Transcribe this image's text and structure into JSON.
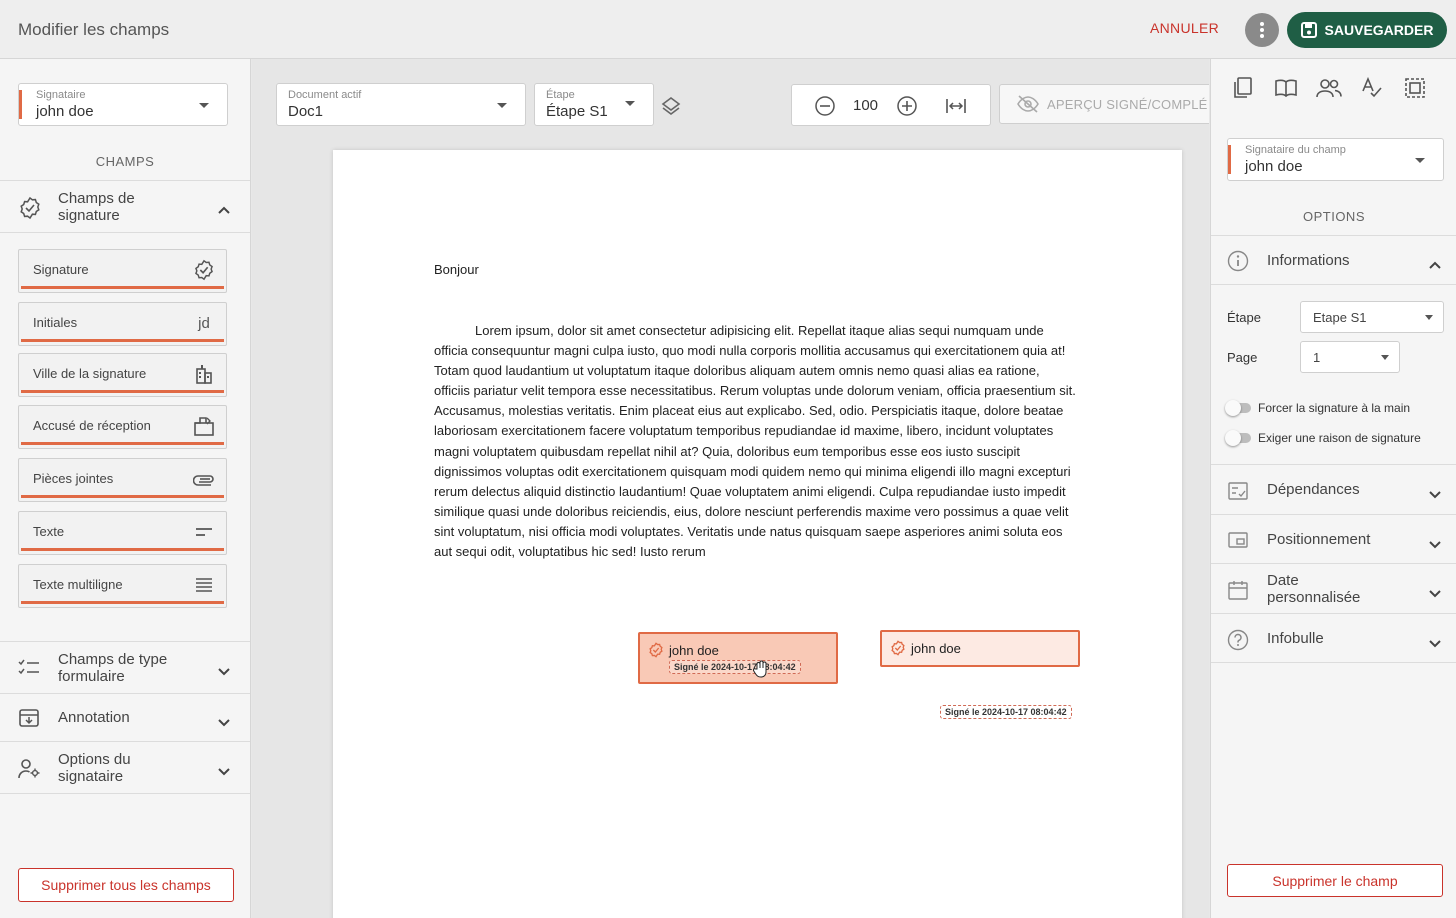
{
  "header": {
    "title": "Modifier les champs",
    "cancel_label": "ANNULER",
    "save_label": "SAUVEGARDER"
  },
  "left_panel": {
    "signer_select": {
      "label": "Signataire",
      "value": "john doe"
    },
    "section_title": "CHAMPS",
    "signature_group": {
      "label": "Champs de signature",
      "items": [
        {
          "label": "Signature",
          "icon": "verified-badge-icon"
        },
        {
          "label": "Initiales",
          "icon_text": "jd"
        },
        {
          "label": "Ville de la signature",
          "icon": "city-icon"
        },
        {
          "label": "Accusé de réception",
          "icon": "inbox-upload-icon"
        },
        {
          "label": "Pièces jointes",
          "icon": "paperclip-icon"
        },
        {
          "label": "Texte",
          "icon": "short-text-icon"
        },
        {
          "label": "Texte multiligne",
          "icon": "multiline-text-icon"
        }
      ]
    },
    "groups": [
      {
        "label": "Champs de type formulaire",
        "icon": "checklist-icon"
      },
      {
        "label": "Annotation",
        "icon": "annotation-icon"
      },
      {
        "label": "Options du signataire",
        "icon": "user-settings-icon"
      }
    ],
    "delete_all_label": "Supprimer tous les champs"
  },
  "toolbar": {
    "document_select": {
      "label": "Document actif",
      "value": "Doc1"
    },
    "step_select": {
      "label": "Étape",
      "value": "Étape S1"
    },
    "zoom_value": "100",
    "preview_label": "APERÇU SIGNÉ/COMPLÉ"
  },
  "document": {
    "greeting": "Bonjour",
    "paragraph": "Lorem ipsum, dolor sit amet consectetur adipisicing elit. Repellat itaque alias sequi numquam unde officia consequuntur magni culpa iusto, quo modi nulla corporis mollitia accusamus qui exercitationem quia at! Totam quod laudantium ut voluptatum itaque doloribus aliquam autem omnis nemo quasi alias ea ratione, officiis pariatur velit tempora esse necessitatibus. Rerum voluptas unde dolorum veniam, officia praesentium sit. Accusamus, molestias veritatis. Enim placeat eius aut explicabo. Sed, odio. Perspiciatis itaque, dolore beatae laboriosam exercitationem facere voluptatum temporibus repudiandae id maxime, libero, incidunt voluptates magni voluptatem quibusdam repellat nihil at? Quia, doloribus eum temporibus esse eos iusto suscipit dignissimos voluptas odit exercitationem quisquam modi quidem nemo qui minima eligendi illo magni excepturi rerum delectus aliquid distinctio laudantium! Quae voluptatem animi eligendi. Culpa repudiandae iusto impedit similique quasi unde doloribus reiciendis, eius, dolore nesciunt perferendis maxime vero possimus a quae velit sint voluptatum, nisi officia modi voluptates. Veritatis unde natus quisquam saepe asperiores animi soluta eos aut sequi odit, voluptatibus hic sed! Iusto rerum",
    "sig_field_1": {
      "name": "john doe",
      "stamp": "Signé le 2024-10-17 08:04:42"
    },
    "sig_field_2": {
      "name": "john doe",
      "stamp": "Signé le 2024-10-17 08:04:42"
    }
  },
  "right_panel": {
    "field_signer_select": {
      "label": "Signataire du champ",
      "value": "john doe"
    },
    "section_title": "OPTIONS",
    "informations": {
      "label": "Informations",
      "step_label": "Étape",
      "step_value": "Etape S1",
      "page_label": "Page",
      "page_value": "1",
      "force_hand_label": "Forcer la signature à la main",
      "require_reason_label": "Exiger une raison de signature"
    },
    "sections": [
      {
        "label": "Dépendances",
        "icon": "dependencies-icon"
      },
      {
        "label": "Positionnement",
        "icon": "position-icon"
      },
      {
        "label": "Date personnalisée",
        "icon": "calendar-icon"
      },
      {
        "label": "Infobulle",
        "icon": "help-icon"
      }
    ],
    "delete_label": "Supprimer le champ"
  },
  "colors": {
    "accent": "#e06a45",
    "primary": "#1f5e45",
    "danger": "#c9332b"
  }
}
